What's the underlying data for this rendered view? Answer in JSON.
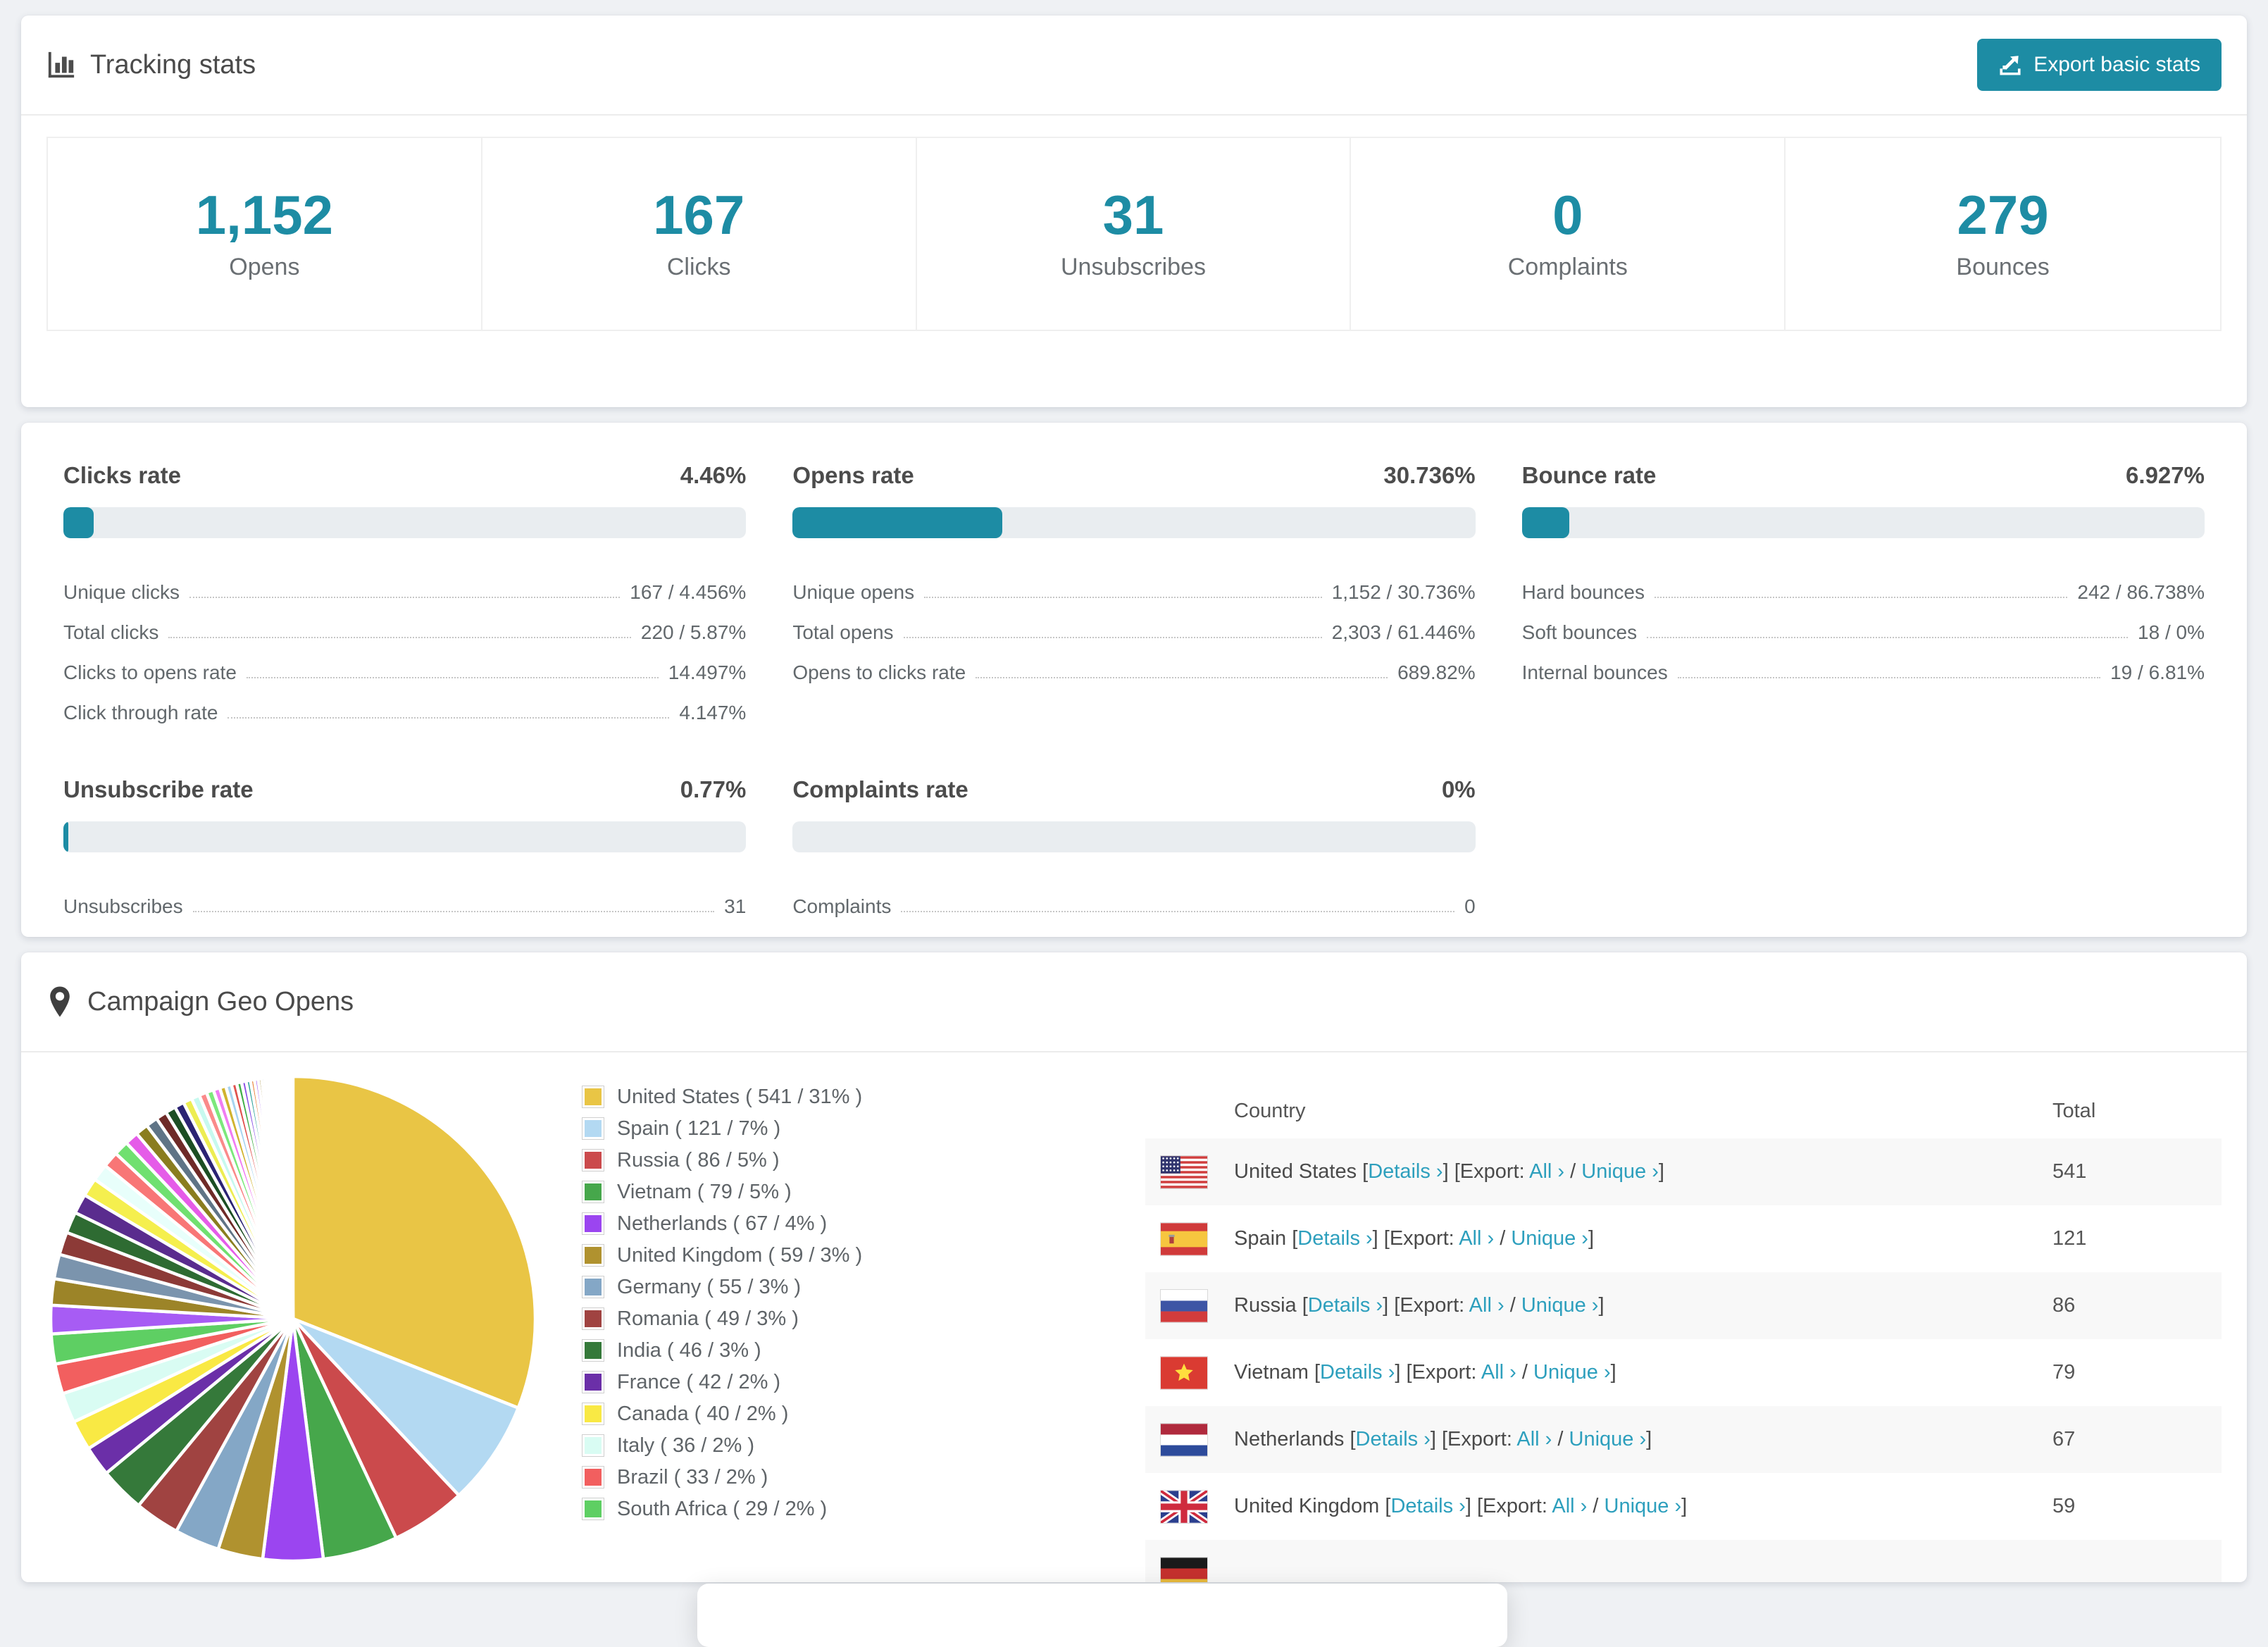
{
  "accent": "#1d8ca4",
  "link_color": "#2d9fbd",
  "page_bg": "#eff1f4",
  "tracking": {
    "title": "Tracking stats",
    "export_button": "Export basic stats",
    "stats": [
      {
        "value": "1,152",
        "label": "Opens"
      },
      {
        "value": "167",
        "label": "Clicks"
      },
      {
        "value": "31",
        "label": "Unsubscribes"
      },
      {
        "value": "0",
        "label": "Complaints"
      },
      {
        "value": "279",
        "label": "Bounces"
      }
    ]
  },
  "rates": {
    "sections": [
      {
        "title": "Clicks rate",
        "value": "4.46%",
        "pct": 4.46,
        "rows": [
          {
            "label": "Unique clicks",
            "value": "167 / 4.456%"
          },
          {
            "label": "Total clicks",
            "value": "220 / 5.87%"
          },
          {
            "label": "Clicks to opens rate",
            "value": "14.497%"
          },
          {
            "label": "Click through rate",
            "value": "4.147%"
          }
        ]
      },
      {
        "title": "Opens rate",
        "value": "30.736%",
        "pct": 30.736,
        "rows": [
          {
            "label": "Unique opens",
            "value": "1,152 / 30.736%"
          },
          {
            "label": "Total opens",
            "value": "2,303 / 61.446%"
          },
          {
            "label": "Opens to clicks rate",
            "value": "689.82%"
          }
        ]
      },
      {
        "title": "Bounce rate",
        "value": "6.927%",
        "pct": 6.927,
        "rows": [
          {
            "label": "Hard bounces",
            "value": "242 / 86.738%"
          },
          {
            "label": "Soft bounces",
            "value": "18 / 0%"
          },
          {
            "label": "Internal bounces",
            "value": "19 / 6.81%"
          }
        ]
      },
      {
        "title": "Unsubscribe rate",
        "value": "0.77%",
        "pct": 0.77,
        "rows": [
          {
            "label": "Unsubscribes",
            "value": "31"
          }
        ]
      },
      {
        "title": "Complaints rate",
        "value": "0%",
        "pct": 0,
        "rows": [
          {
            "label": "Complaints",
            "value": "0"
          }
        ]
      }
    ]
  },
  "geo": {
    "title": "Campaign Geo Opens",
    "links": {
      "details": "Details ›",
      "export_prefix": "Export:",
      "all": "All ›",
      "slash": "/",
      "unique": "Unique ›"
    },
    "table": {
      "headers": {
        "country": "Country",
        "total": "Total"
      },
      "rows": [
        {
          "country": "United States",
          "flag": "us",
          "total": "541"
        },
        {
          "country": "Spain",
          "flag": "es",
          "total": "121"
        },
        {
          "country": "Russia",
          "flag": "ru",
          "total": "86"
        },
        {
          "country": "Vietnam",
          "flag": "vn",
          "total": "79"
        },
        {
          "country": "Netherlands",
          "flag": "nl",
          "total": "67"
        },
        {
          "country": "United Kingdom",
          "flag": "gb",
          "total": "59"
        },
        {
          "country": "",
          "flag": "de",
          "total": "",
          "partial": true
        }
      ]
    }
  },
  "chart_data": {
    "type": "pie",
    "title": "Campaign Geo Opens",
    "legend_position": "right",
    "start_angle_deg": -90,
    "direction": "clockwise",
    "gap_color": "#ffffff",
    "series": [
      {
        "label": "United States",
        "value": 541,
        "pct": 31,
        "color": "#e9c545"
      },
      {
        "label": "Spain",
        "value": 121,
        "pct": 7,
        "color": "#b3d9f2"
      },
      {
        "label": "Russia",
        "value": 86,
        "pct": 5,
        "color": "#cb4a4c"
      },
      {
        "label": "Vietnam",
        "value": 79,
        "pct": 5,
        "color": "#46a74b"
      },
      {
        "label": "Netherlands",
        "value": 67,
        "pct": 4,
        "color": "#9b45f0"
      },
      {
        "label": "United Kingdom",
        "value": 59,
        "pct": 3,
        "color": "#b0922f"
      },
      {
        "label": "Germany",
        "value": 55,
        "pct": 3,
        "color": "#84a7c6"
      },
      {
        "label": "Romania",
        "value": 49,
        "pct": 3,
        "color": "#a04341"
      },
      {
        "label": "India",
        "value": 46,
        "pct": 3,
        "color": "#35793a"
      },
      {
        "label": "France",
        "value": 42,
        "pct": 2,
        "color": "#6b2fa8"
      },
      {
        "label": "Canada",
        "value": 40,
        "pct": 2,
        "color": "#f9e944"
      },
      {
        "label": "Italy",
        "value": 36,
        "pct": 2,
        "color": "#d9fcf3"
      },
      {
        "label": "Brazil",
        "value": 33,
        "pct": 2,
        "color": "#f25f5f"
      },
      {
        "label": "South Africa",
        "value": 29,
        "pct": 2,
        "color": "#5ecf63"
      }
    ],
    "legend_label_format": "{label} ( {value} / {pct}% )",
    "others": {
      "note": "remaining small countries drawn as thinning fan",
      "total_pct": 26,
      "first_slice_deg": 6.8,
      "decay": 0.93,
      "count": 45,
      "colors": [
        "#a75cf4",
        "#9c8428",
        "#7b94ad",
        "#8c3a37",
        "#2e6b32",
        "#5a2c8e",
        "#f5ef4e",
        "#e8fffb",
        "#f87676",
        "#70e070",
        "#e55ce8",
        "#8a7d1f",
        "#5f7486",
        "#6e2a27",
        "#1c4e23",
        "#2b2373",
        "#eded52",
        "#c7f9ef",
        "#fa8a8a",
        "#7ce87c",
        "#f07df2",
        "#d1b32f",
        "#a8d4f0",
        "#e0524e",
        "#3fae47",
        "#8a52e6",
        "#2aa198",
        "#e87b2e"
      ]
    }
  }
}
